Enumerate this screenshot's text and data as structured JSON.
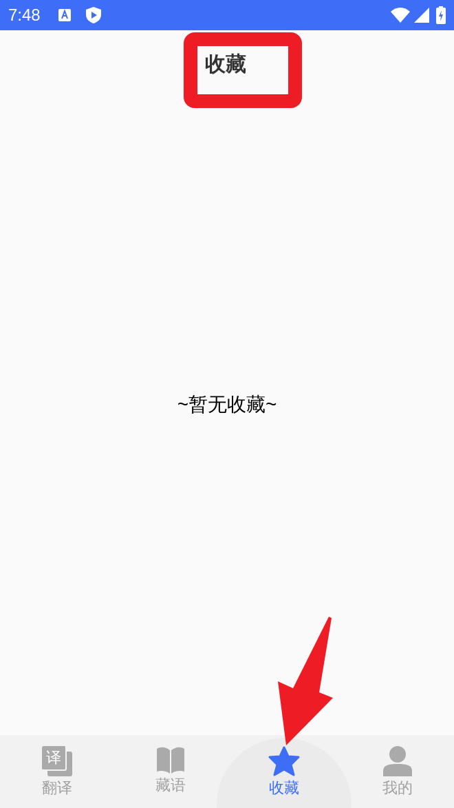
{
  "status_bar": {
    "time": "7:48"
  },
  "header": {
    "title": "收藏"
  },
  "empty_message": "~暂无收藏~",
  "tabs": [
    {
      "label": "翻译",
      "kind": "translate",
      "icon_text": "译",
      "selected": false
    },
    {
      "label": "藏语",
      "kind": "book",
      "selected": false
    },
    {
      "label": "收藏",
      "kind": "star",
      "selected": true
    },
    {
      "label": "我的",
      "kind": "person",
      "selected": false
    }
  ]
}
